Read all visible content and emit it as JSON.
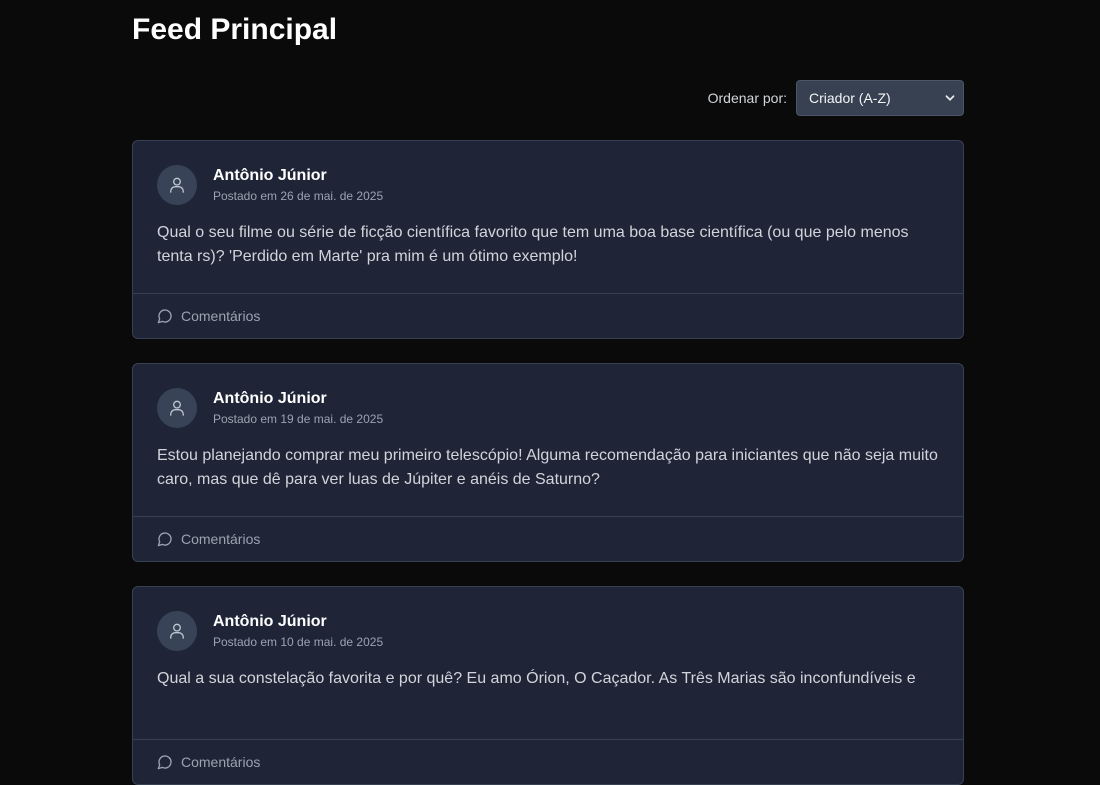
{
  "page_title": "Feed Principal",
  "sort": {
    "label": "Ordenar por:",
    "selected": "Criador (A-Z)"
  },
  "posts": [
    {
      "author": "Antônio Júnior",
      "date": "Postado em 26 de mai. de 2025",
      "content": "Qual o seu filme ou série de ficção científica favorito que tem uma boa base científica (ou que pelo menos tenta rs)? 'Perdido em Marte' pra mim é um ótimo exemplo!",
      "comments_label": "Comentários"
    },
    {
      "author": "Antônio Júnior",
      "date": "Postado em 19 de mai. de 2025",
      "content": "Estou planejando comprar meu primeiro telescópio! Alguma recomendação para iniciantes que não seja muito caro, mas que dê para ver luas de Júpiter e anéis de Saturno?",
      "comments_label": "Comentários"
    },
    {
      "author": "Antônio Júnior",
      "date": "Postado em 10 de mai. de 2025",
      "content": "Qual a sua constelação favorita e por quê? Eu amo Órion, O Caçador. As Três Marias são inconfundíveis e",
      "comments_label": "Comentários"
    }
  ]
}
